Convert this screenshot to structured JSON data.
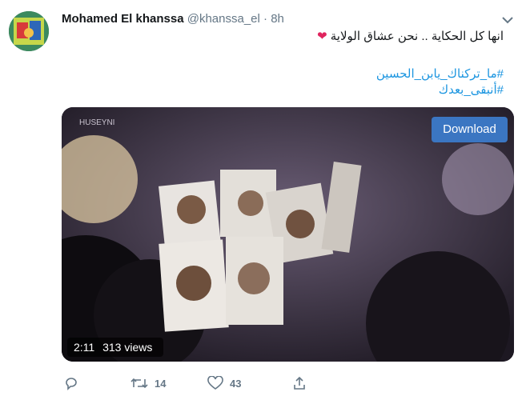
{
  "tweet": {
    "author_name": "Mohamed El khanssa",
    "handle": "@khanssa_el",
    "separator": "·",
    "time": "8h",
    "text": "انها كل الحكاية .. نحن عشاق الولاية",
    "emoji": "❤",
    "hashtags": [
      "#ما_تركناك_يابن_الحسين",
      "#أنبقى_بعدك"
    ]
  },
  "media": {
    "download_label": "Download",
    "duration": "2:11",
    "views": "313 views",
    "watermark": "HUSEYNI"
  },
  "actions": {
    "retweets": "14",
    "likes": "43"
  },
  "colors": {
    "link": "#1b95e0",
    "download_button": "#3b76c2",
    "like": "#e0245e"
  },
  "icons": [
    "avatar",
    "chevron-down-icon",
    "reply-icon",
    "retweet-icon",
    "like-icon",
    "share-icon"
  ]
}
